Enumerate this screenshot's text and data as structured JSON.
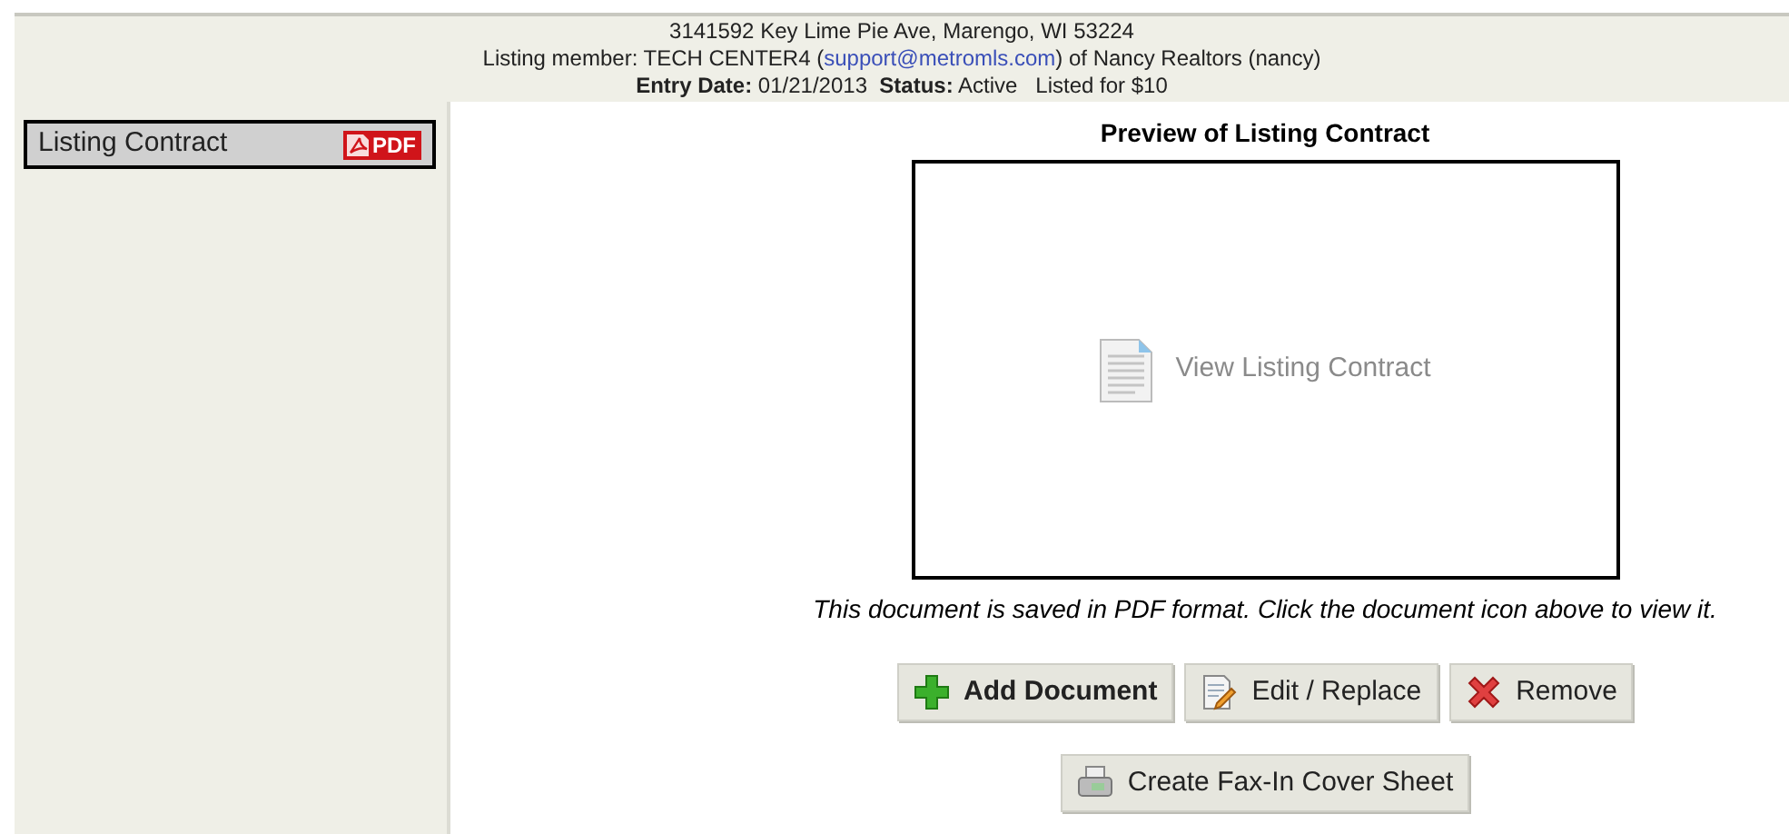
{
  "header": {
    "address": "3141592 Key Lime Pie Ave, Marengo, WI 53224",
    "member_prefix": "Listing member: TECH CENTER4 (",
    "member_email": "support@metromls.com",
    "member_suffix": ") of Nancy Realtors (nancy)",
    "details": "**Entry Date:** 01/21/2013  **Status:** Active   Listed for $10"
  },
  "sidebar": {
    "items": [
      {
        "label": "Listing Contract",
        "badge": "PDF",
        "selected": true
      }
    ]
  },
  "preview": {
    "title": "Preview of Listing Contract",
    "link": "View Listing Contract",
    "note": "This document is saved in PDF format. Click the document icon above to view it."
  },
  "buttons": [
    {
      "kind": "add",
      "label": "Add Document"
    },
    {
      "kind": "edit",
      "label": "Edit / Replace"
    },
    {
      "kind": "remove",
      "label": "Remove"
    },
    {
      "kind": "fax",
      "label": "Create Fax-In Cover Sheet"
    }
  ]
}
